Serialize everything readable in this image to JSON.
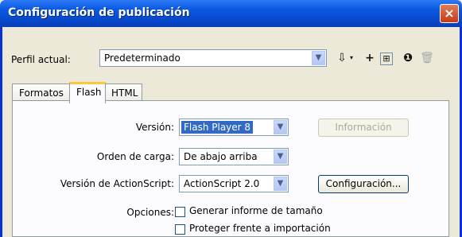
{
  "window": {
    "title": "Configuración de publicación",
    "close_icon": "×"
  },
  "profile": {
    "label": "Perfil actual:",
    "value": "Predeterminado",
    "toolbar_icons": [
      "import-export-icon",
      "add-icon",
      "duplicate-icon",
      "info-icon",
      "trash-icon"
    ]
  },
  "tabs": [
    {
      "label": "Formatos"
    },
    {
      "label": "Flash"
    },
    {
      "label": "HTML"
    }
  ],
  "flash": {
    "version_label": "Versión:",
    "version_value": "Flash Player 8",
    "info_button": "Información",
    "load_order_label": "Orden de carga:",
    "load_order_value": "De abajo arriba",
    "actionscript_label": "Versión de ActionScript:",
    "actionscript_value": "ActionScript 2.0",
    "settings_button": "Configuración...",
    "options_label": "Opciones:",
    "options": [
      {
        "label": "Generar informe de tamaño",
        "checked": false
      },
      {
        "label": "Proteger frente a importación",
        "checked": false
      }
    ]
  }
}
